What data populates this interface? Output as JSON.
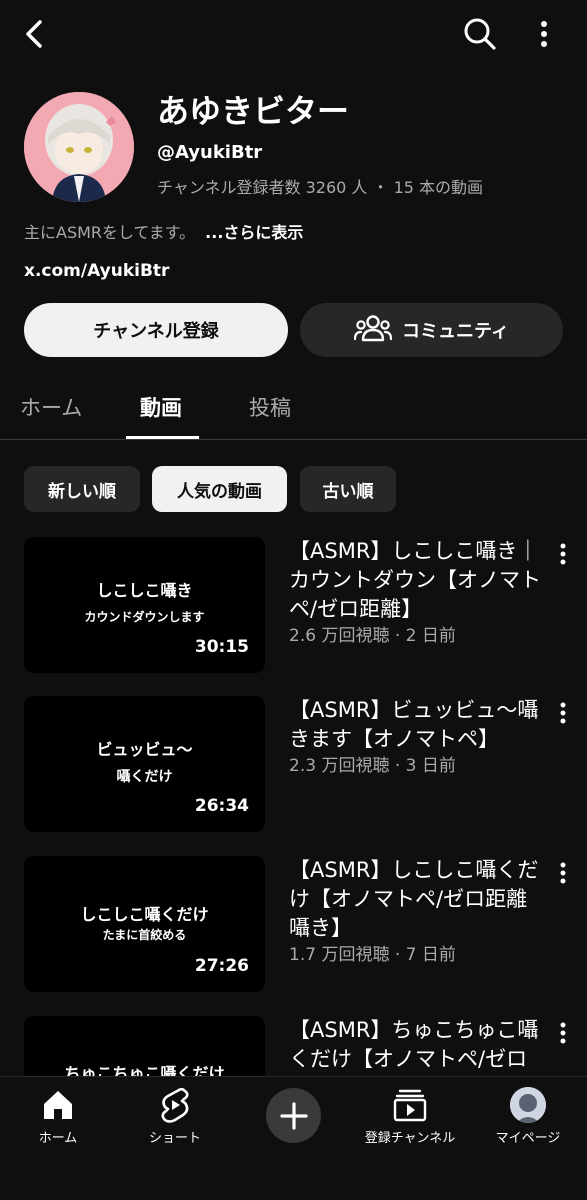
{
  "channel": {
    "name": "あゆきビター",
    "handle": "@AyukiBtr",
    "stats": "チャンネル登録者数 3260 人 ・ 15 本の動画",
    "description": "主にASMRをしてます。",
    "more_label": "...さらに表示",
    "link": "x.com/AyukiBtr"
  },
  "actions": {
    "subscribe_label": "チャンネル登録",
    "community_label": "コミュニティ"
  },
  "tabs": [
    {
      "label": "ホーム"
    },
    {
      "label": "動画"
    },
    {
      "label": "投稿"
    }
  ],
  "chips": [
    {
      "label": "新しい順"
    },
    {
      "label": "人気の動画"
    },
    {
      "label": "古い順"
    }
  ],
  "videos": [
    {
      "thumb_line1": "しこしこ囁き",
      "thumb_line2": "カウンドダウンします",
      "duration": "30:15",
      "title": "【ASMR】しこしこ囁き｜カウントダウン【オノマトペ/ゼロ距離】",
      "meta": "2.6 万回視聴 · 2 日前"
    },
    {
      "thumb_line1": "ビュッビュ〜",
      "thumb_line2": "囁くだけ",
      "duration": "26:34",
      "title": "【ASMR】ビュッビュ〜囁きます【オノマトペ】",
      "meta": "2.3 万回視聴 · 3 日前"
    },
    {
      "thumb_line1": "しこしこ囁くだけ",
      "thumb_line2": "たまに首絞める",
      "duration": "27:26",
      "title": "【ASMR】しこしこ囁くだけ【オノマトペ/ゼロ距離囁き】",
      "meta": "1.7 万回視聴 · 7 日前"
    },
    {
      "thumb_line1": "ちゅこちゅこ囁くだけ",
      "thumb_line2": "",
      "duration": "",
      "title": "【ASMR】ちゅこちゅこ囁くだけ【オノマトペ/ゼロ距離囁き】",
      "meta": ""
    }
  ],
  "bottom_nav": [
    {
      "label": "ホーム"
    },
    {
      "label": "ショート"
    },
    {
      "label": "登録チャンネル"
    },
    {
      "label": "マイページ"
    }
  ]
}
